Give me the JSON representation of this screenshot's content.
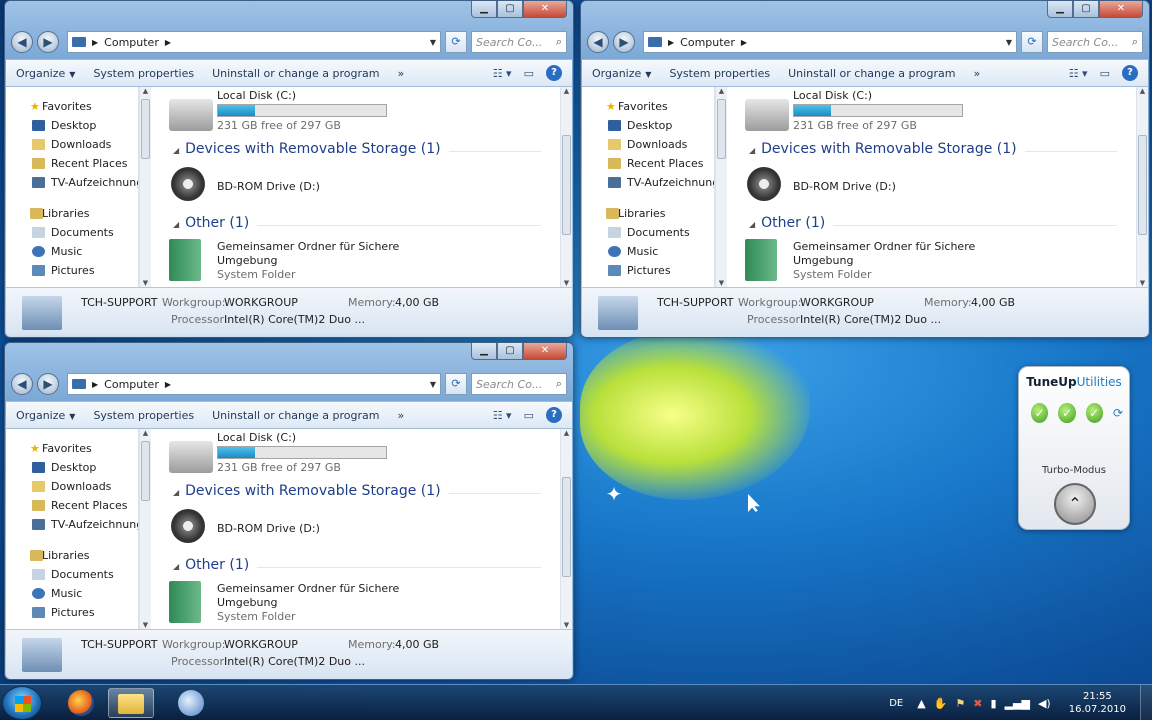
{
  "colors": {
    "accent": "#1e3e8a",
    "progress": "#2a9fd6",
    "taskbar": "#173b63"
  },
  "windows": [
    {
      "address": {
        "location": "Computer"
      },
      "search_placeholder": "Search Co...",
      "toolbar": {
        "organize": "Organize",
        "system_properties": "System properties",
        "uninstall": "Uninstall or change a program",
        "more": "»"
      },
      "nav": {
        "favorites": "Favorites",
        "favorites_items": [
          "Desktop",
          "Downloads",
          "Recent Places",
          "TV-Aufzeichnungen"
        ],
        "libraries": "Libraries",
        "libraries_items": [
          "Documents",
          "Music",
          "Pictures"
        ]
      },
      "local_disk": {
        "name": "Local Disk (C:)",
        "free": "231 GB free of 297 GB",
        "used_fraction": 0.22
      },
      "removable_group": "Devices with Removable Storage (1)",
      "bd_drive": "BD-ROM Drive (D:)",
      "other_group": "Other (1)",
      "folder": {
        "name_line1": "Gemeinsamer Ordner für Sichere",
        "name_line2": "Umgebung",
        "type": "System Folder"
      },
      "status": {
        "computer": "TCH-SUPPORT",
        "workgroup_label": "Workgroup:",
        "workgroup": "WORKGROUP",
        "memory_label": "Memory:",
        "memory": "4,00 GB",
        "processor_label": "Processor:",
        "processor": "Intel(R) Core(TM)2 Duo ..."
      }
    }
  ],
  "gadget": {
    "title_a": "TuneUp",
    "title_b": "Utilities",
    "turbo": "Turbo-Modus"
  },
  "taskbar": {
    "language": "DE",
    "time": "21:55",
    "date": "16.07.2010"
  }
}
